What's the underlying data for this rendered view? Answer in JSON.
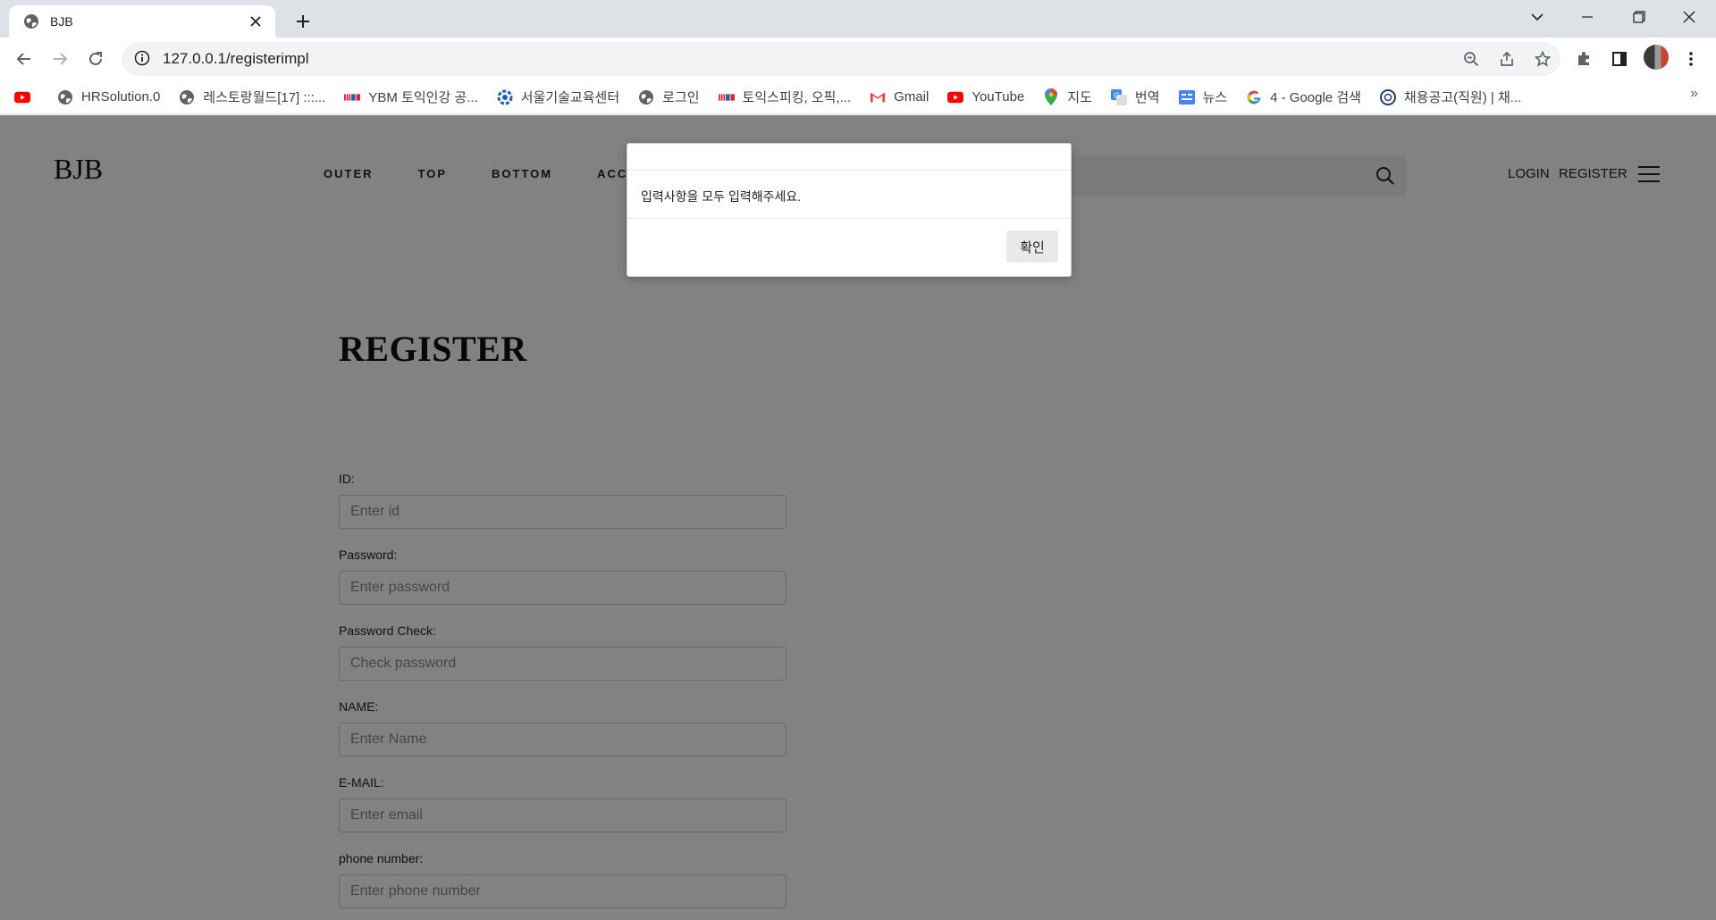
{
  "browser": {
    "tab_title": "BJB",
    "url": "127.0.0.1/registerimpl",
    "bookmarks": [
      {
        "label": "",
        "icon": "youtube-icon"
      },
      {
        "label": "HRSolution.0",
        "icon": "globe-icon"
      },
      {
        "label": "레스토랑월드[17] :::...",
        "icon": "globe-icon"
      },
      {
        "label": "YBM 토익인강 공...",
        "icon": "ybm-icon"
      },
      {
        "label": "서울기술교육센터",
        "icon": "gear-logo-icon"
      },
      {
        "label": "로그인",
        "icon": "globe-icon"
      },
      {
        "label": "토익스피킹, 오픽,...",
        "icon": "ybm-icon"
      },
      {
        "label": "Gmail",
        "icon": "gmail-icon"
      },
      {
        "label": "YouTube",
        "icon": "youtube-icon"
      },
      {
        "label": "지도",
        "icon": "maps-pin-icon"
      },
      {
        "label": "번역",
        "icon": "translate-icon"
      },
      {
        "label": "뉴스",
        "icon": "news-icon"
      },
      {
        "label": "4 - Google 검색",
        "icon": "google-icon"
      },
      {
        "label": "채용공고(직원) | 채...",
        "icon": "seal-icon"
      }
    ],
    "more_label": "»"
  },
  "site": {
    "logo": "BJB",
    "nav": [
      "OUTER",
      "TOP",
      "BOTTOM",
      "ACC"
    ],
    "login_label": "LOGIN",
    "register_label": "REGISTER"
  },
  "form": {
    "title": "REGISTER",
    "fields": [
      {
        "label": "ID:",
        "placeholder": "Enter id"
      },
      {
        "label": "Password:",
        "placeholder": "Enter password"
      },
      {
        "label": "Password Check:",
        "placeholder": "Check password"
      },
      {
        "label": "NAME:",
        "placeholder": "Enter Name"
      },
      {
        "label": "E-MAIL:",
        "placeholder": "Enter email"
      },
      {
        "label": "phone number:",
        "placeholder": "Enter phone number"
      }
    ]
  },
  "dialog": {
    "message": "입력사항을 모두 입력해주세요.",
    "ok_label": "확인"
  },
  "colors": {
    "overlay": "#000000",
    "tabbar": "#dee1e6",
    "omnibox": "#f1f3f4"
  }
}
